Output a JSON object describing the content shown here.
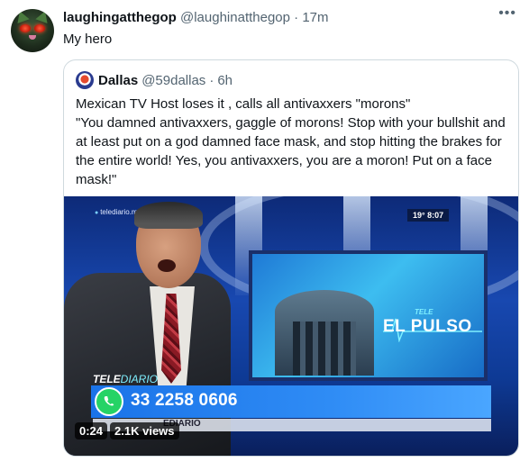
{
  "tweet": {
    "display_name": "laughingatthegop",
    "handle": "@laughinatthegop",
    "separator": "·",
    "time": "17m",
    "text": "My hero",
    "more_icon": "more-horizontal-icon"
  },
  "quote": {
    "display_name": "Dallas",
    "handle": "@59dallas",
    "separator": "·",
    "time": "6h",
    "text_lines": [
      "Mexican TV Host loses it , calls all antivaxxers \"morons\"",
      "\"You damned antivaxxers, gaggle of morons! Stop with your bullshit and at least put on a god damned face mask, and stop hitting the brakes for the entire world! Yes, you antivaxxers, you are a moron! Put on a face mask!\""
    ]
  },
  "video": {
    "site_badge": "telediario.mx",
    "weather": "19°  8:07",
    "monitor_small": "TELE",
    "monitor_title": "EL PULSO",
    "channel_logo_main": "TELE",
    "channel_logo_sub": "DIARIO",
    "phone_number": "33 2258 0606",
    "lower_third": "EDIARIO",
    "duration": "0:24",
    "views": "2.1K views"
  },
  "colors": {
    "accent": "#1d9bf0",
    "secondary_text": "#536471",
    "border": "#cfd9de",
    "whatsapp": "#25d366"
  }
}
